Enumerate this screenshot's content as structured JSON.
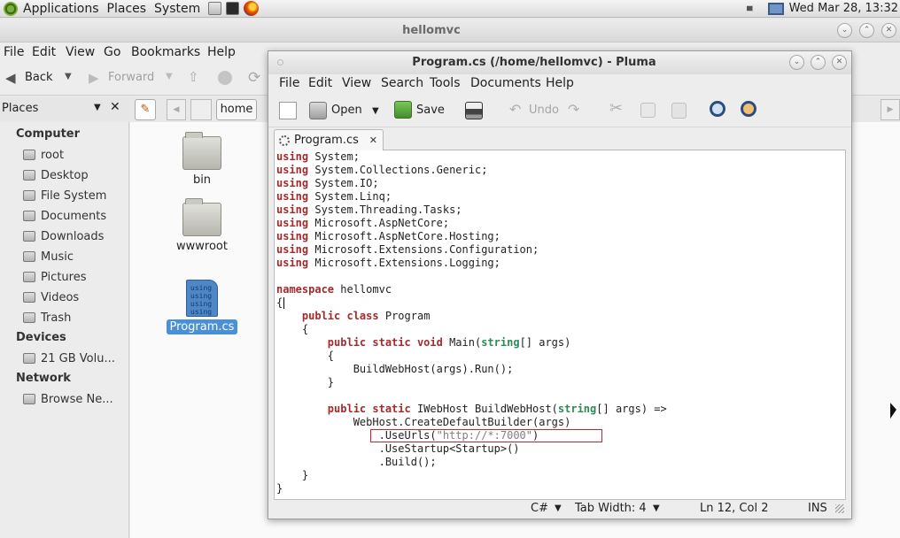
{
  "top_panel": {
    "menus": [
      "Applications",
      "Places",
      "System"
    ],
    "clock": "Wed Mar 28, 13:32"
  },
  "file_manager": {
    "title": "hellomvc",
    "menus": [
      "File",
      "Edit",
      "View",
      "Go",
      "Bookmarks",
      "Help"
    ],
    "toolbar": {
      "back": "Back",
      "forward": "Forward",
      "path_segment": "home"
    },
    "places_label": "Places",
    "sidebar": {
      "computer_header": "Computer",
      "computer_items": [
        "root",
        "Desktop",
        "File System",
        "Documents",
        "Downloads",
        "Music",
        "Pictures",
        "Videos",
        "Trash"
      ],
      "devices_header": "Devices",
      "devices_items": [
        "21 GB Volu..."
      ],
      "network_header": "Network",
      "network_items": [
        "Browse Ne..."
      ]
    },
    "files": [
      {
        "name": "bin",
        "kind": "folder"
      },
      {
        "name": "wwwroot",
        "kind": "folder"
      },
      {
        "name": "Program.cs",
        "kind": "cs-file",
        "selected": true
      }
    ],
    "cs_icon_text": "using"
  },
  "editor": {
    "title": "Program.cs (/home/hellomvc) - Pluma",
    "menus": [
      "File",
      "Edit",
      "View",
      "Search",
      "Tools",
      "Documents",
      "Help"
    ],
    "toolbar": {
      "open": "Open",
      "save": "Save",
      "undo": "Undo"
    },
    "tab_label": "Program.cs",
    "code": {
      "using_kw": "using",
      "usings": [
        "System;",
        "System.Collections.Generic;",
        "System.IO;",
        "System.Linq;",
        "System.Threading.Tasks;",
        "Microsoft.AspNetCore;",
        "Microsoft.AspNetCore.Hosting;",
        "Microsoft.Extensions.Configuration;",
        "Microsoft.Extensions.Logging;"
      ],
      "namespace_kw": "namespace",
      "namespace_name": "hellomvc",
      "open_brace": "{",
      "close_brace": "}",
      "class_kw": "public class",
      "class_name": "Program",
      "main_kw": "public static void",
      "main_sig_a": "Main(",
      "string_kw": "string",
      "main_sig_b": "[] args)",
      "run_line": "BuildWebHost(args).Run();",
      "host_kw": "public static",
      "host_sig_a": "IWebHost BuildWebHost(",
      "host_sig_b": "[] args) =>",
      "builder_line": "WebHost.CreateDefaultBuilder(args)",
      "useurls_a": ".UseUrls(",
      "useurls_str": "\"http://*:7000\"",
      "useurls_b": ")",
      "startup_line": ".UseStartup<Startup>()",
      "build_line": ".Build();"
    },
    "status": {
      "language": "C#",
      "tab_width": "Tab Width:  4",
      "position": "Ln 12, Col 2",
      "mode": "INS"
    }
  }
}
